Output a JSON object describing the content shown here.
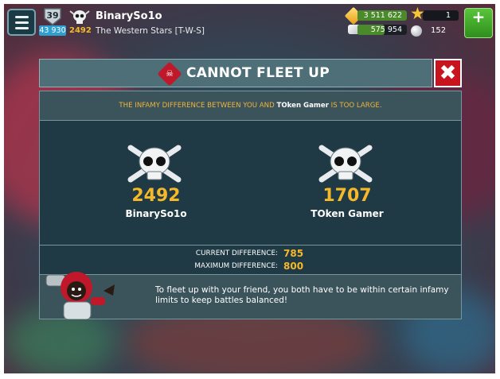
{
  "hud": {
    "level": "39",
    "xp": "43 930",
    "infamy": "2492",
    "player_name": "BinarySo1o",
    "fleet_name": "The Western Stars [T-W-S]",
    "gold": "3 511 622",
    "stone": "575 954",
    "stars": "1",
    "balls": "152",
    "shop_label": "+"
  },
  "dialog": {
    "title": "CANNOT FLEET UP",
    "close_label": "✖",
    "notice_prefix": "THE INFAMY DIFFERENCE BETWEEN YOU AND ",
    "notice_name": "TOken Gamer",
    "notice_suffix": " IS TOO LARGE.",
    "player_left": {
      "infamy": "2492",
      "name": "BinarySo1o"
    },
    "player_right": {
      "infamy": "1707",
      "name": "TOken Gamer"
    },
    "current_difference_label": "CURRENT DIFFERENCE:",
    "current_difference_value": "785",
    "maximum_difference_label": "MAXIMUM DIFFERENCE:",
    "maximum_difference_value": "800",
    "info_text": "To fleet up with your friend, you both have to be within certain infamy limits to keep battles balanced!"
  },
  "colors": {
    "accent_gold": "#f5b82a",
    "close_red": "#c8141e",
    "panel": "#1f3a44"
  }
}
